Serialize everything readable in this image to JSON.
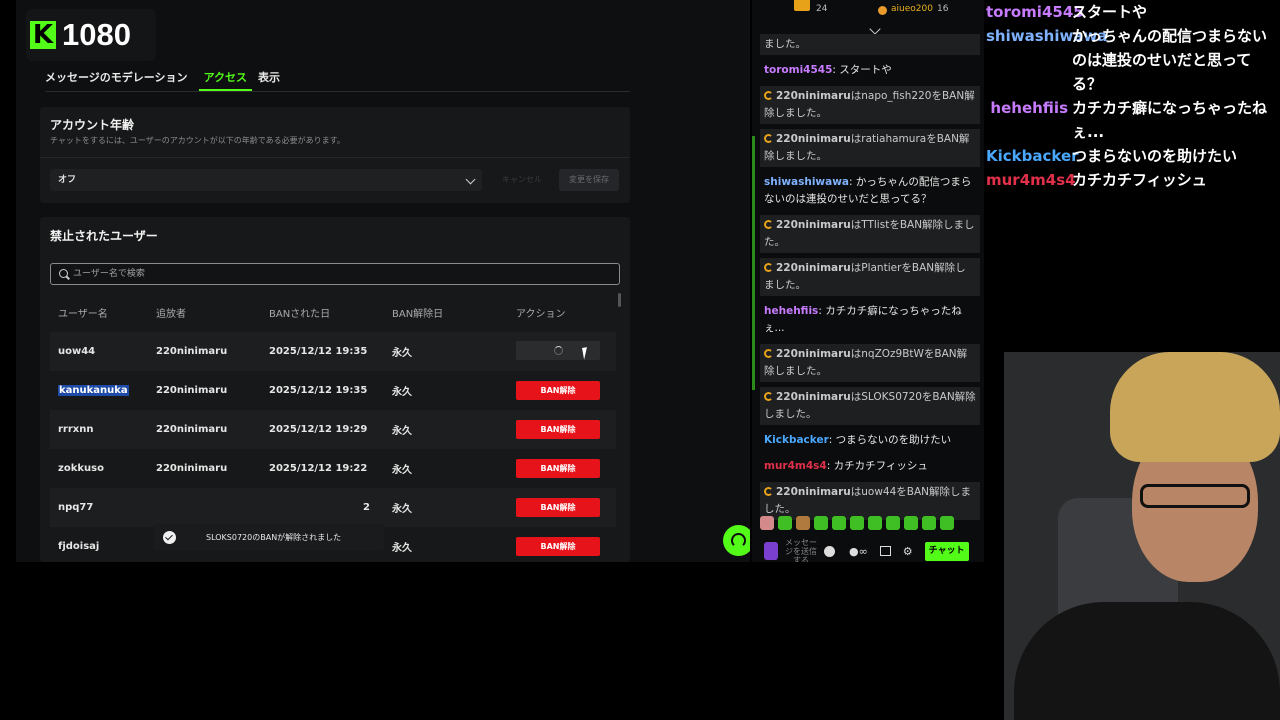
{
  "stream_overlay": {
    "resolution_label": "1080"
  },
  "tabs": [
    {
      "label": "メッセージのモデレーション"
    },
    {
      "label": "アクセス"
    },
    {
      "label": "表示"
    }
  ],
  "account_age": {
    "title": "アカウント年齢",
    "subtitle": "チャットをするには、ユーザーのアカウントが以下の年齢である必要があります。",
    "selected": "オフ",
    "cancel_label": "キャンセル",
    "save_label": "変更を保存"
  },
  "banned_users": {
    "title": "禁止されたユーザー",
    "search_placeholder": "ユーザー名で検索",
    "columns": [
      "ユーザー名",
      "追放者",
      "BANされた日",
      "BAN解除日",
      "アクション"
    ],
    "unban_label": "BAN解除",
    "rows": [
      {
        "user": "uow44",
        "banned_by": "220ninimaru",
        "date": "2025/12/12 19:35",
        "until": "永久",
        "action": "loading"
      },
      {
        "user": "kanukanuka",
        "banned_by": "220ninimaru",
        "date": "2025/12/12 19:35",
        "until": "永久",
        "action": "unban"
      },
      {
        "user": "rrrxnn",
        "banned_by": "220ninimaru",
        "date": "2025/12/12 19:29",
        "until": "永久",
        "action": "unban"
      },
      {
        "user": "zokkuso",
        "banned_by": "220ninimaru",
        "date": "2025/12/12 19:22",
        "until": "永久",
        "action": "unban"
      },
      {
        "user": "npq77",
        "banned_by": "",
        "date": "2",
        "until": "永久",
        "action": "unban"
      },
      {
        "user": "fjdoisaj",
        "banned_by": "",
        "date": "",
        "until": "永久",
        "action": "unban"
      }
    ]
  },
  "toast": {
    "message": "SLOKS0720のBANが解除されました"
  },
  "chat": {
    "top_count_1": "24",
    "top_user_2": "aiueo200",
    "top_count_2": "16",
    "messages": [
      {
        "type": "sys",
        "text": "ました。"
      },
      {
        "type": "user",
        "user": "toromi4545",
        "color": "#c77cff",
        "text": "スタートや"
      },
      {
        "type": "sys",
        "user": "220ninimaru",
        "text": "はnapo_fish220をBAN解除しました。"
      },
      {
        "type": "sys",
        "user": "220ninimaru",
        "text": "はratiahamuraをBAN解除しました。"
      },
      {
        "type": "user",
        "user": "shiwashiwawa",
        "color": "#7fb2ff",
        "text": "かっちゃんの配信つまらないのは連投のせいだと思ってる？"
      },
      {
        "type": "sys",
        "user": "220ninimaru",
        "text": "はTTlistをBAN解除しました。"
      },
      {
        "type": "sys",
        "user": "220ninimaru",
        "text": "はPlantierをBAN解除しました。"
      },
      {
        "type": "user",
        "user": "hehehfiis",
        "color": "#c77cff",
        "text": "カチカチ癖になっちゃったねぇ..."
      },
      {
        "type": "sys",
        "user": "220ninimaru",
        "text": "はnqZOz9BtWをBAN解除しました。"
      },
      {
        "type": "sys",
        "user": "220ninimaru",
        "text": "はSLOKS0720をBAN解除しました。"
      },
      {
        "type": "user",
        "user": "Kickbacker",
        "color": "#4aa8ff",
        "text": "つまらないのを助けたい"
      },
      {
        "type": "user",
        "user": "mur4m4s4",
        "color": "#e0304a",
        "text": "カチカチフィッシュ"
      },
      {
        "type": "sys",
        "user": "220ninimaru",
        "text": "はuow44をBAN解除しました。"
      }
    ],
    "input_placeholder": "メッセージを送信する",
    "send_label": "チャット"
  },
  "overlay_chat": [
    {
      "user": "toromi4545",
      "color": "#c77cff",
      "text": "スタートや"
    },
    {
      "user": "shiwashiwawa",
      "color": "#7fb2ff",
      "text": "かっちゃんの配信つまらないのは連投のせいだと思ってる？"
    },
    {
      "user": "hehehfiis",
      "color": "#c77cff",
      "text": "カチカチ癖になっちゃったねぇ..."
    },
    {
      "user": "Kickbacker",
      "color": "#4aa8ff",
      "text": "つまらないのを助けたい"
    },
    {
      "user": "mur4m4s4",
      "color": "#e0304a",
      "text": "カチカチフィッシュ"
    }
  ],
  "colors": {
    "accent": "#53fc18",
    "danger": "#e6141a",
    "panel_bg": "#0e0f10"
  }
}
